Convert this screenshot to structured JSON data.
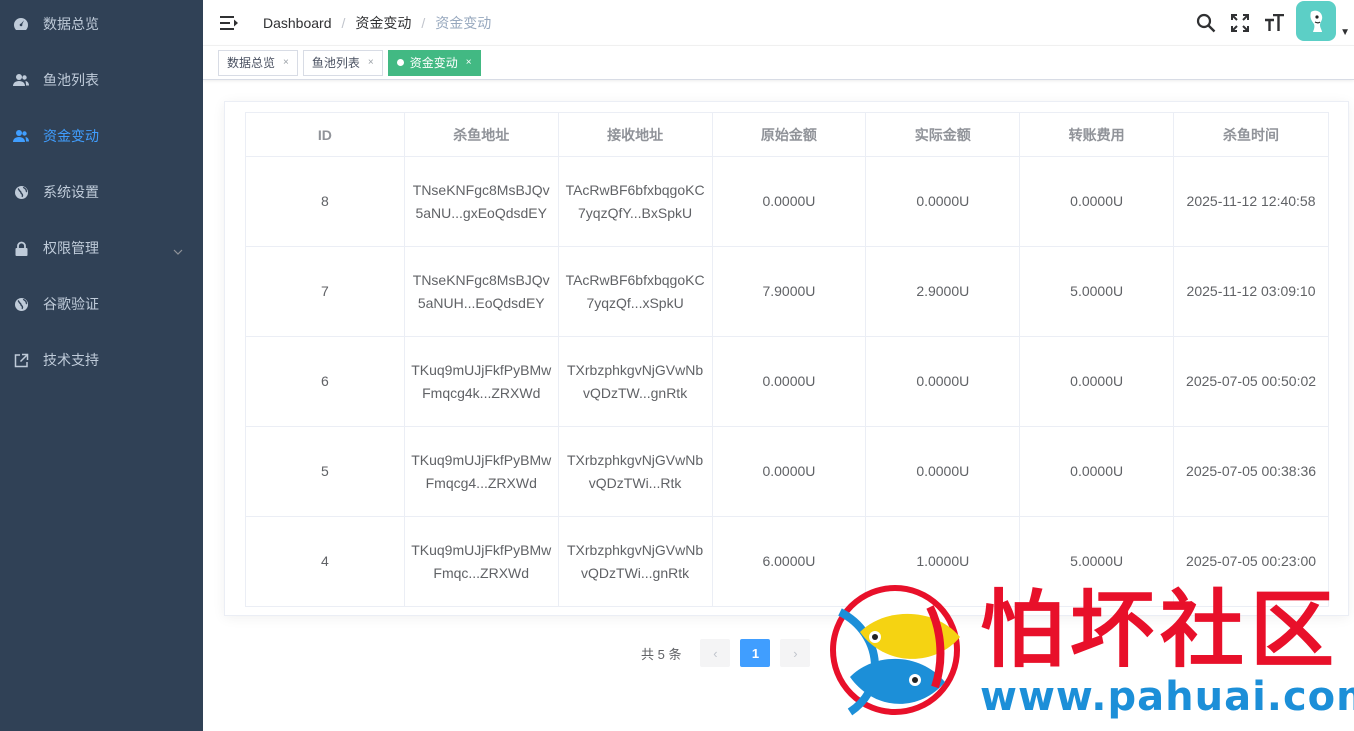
{
  "sidebar": {
    "items": [
      {
        "label": "数据总览",
        "icon": "dashboard-icon"
      },
      {
        "label": "鱼池列表",
        "icon": "users-icon"
      },
      {
        "label": "资金变动",
        "icon": "users-icon",
        "active": true
      },
      {
        "label": "系统设置",
        "icon": "globe-icon"
      },
      {
        "label": "权限管理",
        "icon": "lock-icon"
      },
      {
        "label": "谷歌验证",
        "icon": "globe-icon"
      },
      {
        "label": "技术支持",
        "icon": "external-link-icon"
      }
    ]
  },
  "navbar": {
    "breadcrumb": [
      "Dashboard",
      "资金变动",
      "资金变动"
    ],
    "separator": "/"
  },
  "tags": [
    {
      "label": "数据总览",
      "close": "×"
    },
    {
      "label": "鱼池列表",
      "close": "×"
    },
    {
      "label": "资金变动",
      "close": "×"
    }
  ],
  "table": {
    "headers": [
      "ID",
      "杀鱼地址",
      "接收地址",
      "原始金额",
      "实际金额",
      "转账费用",
      "杀鱼时间"
    ],
    "rows": [
      {
        "id": "8",
        "kill_addr": "TNseKNFgc8MsBJQv5aNU...gxEoQdsdEY",
        "recv_addr": "TAcRwBF6bfxbqgoKC7yqzQfY...BxSpkU",
        "original": "0.0000U",
        "actual": "0.0000U",
        "fee": "0.0000U",
        "time": "2025-11-12 12:40:58"
      },
      {
        "id": "7",
        "kill_addr": "TNseKNFgc8MsBJQv5aNUH...EoQdsdEY",
        "recv_addr": "TAcRwBF6bfxbqgoKC7yqzQf...xSpkU",
        "original": "7.9000U",
        "actual": "2.9000U",
        "fee": "5.0000U",
        "time": "2025-11-12 03:09:10"
      },
      {
        "id": "6",
        "kill_addr": "TKuq9mUJjFkfPyBMwFmqcg4k...ZRXWd",
        "recv_addr": "TXrbzphkgvNjGVwNbvQDzTW...gnRtk",
        "original": "0.0000U",
        "actual": "0.0000U",
        "fee": "0.0000U",
        "time": "2025-07-05 00:50:02"
      },
      {
        "id": "5",
        "kill_addr": "TKuq9mUJjFkfPyBMwFmqcg4...ZRXWd",
        "recv_addr": "TXrbzphkgvNjGVwNbvQDzTWi...Rtk",
        "original": "0.0000U",
        "actual": "0.0000U",
        "fee": "0.0000U",
        "time": "2025-07-05 00:38:36"
      },
      {
        "id": "4",
        "kill_addr": "TKuq9mUJjFkfPyBMwFmqc...ZRXWd",
        "recv_addr": "TXrbzphkgvNjGVwNbvQDzTWi...gnRtk",
        "original": "6.0000U",
        "actual": "1.0000U",
        "fee": "5.0000U",
        "time": "2025-07-05 00:23:00"
      }
    ]
  },
  "pagination": {
    "total": "共 5 条",
    "prev": "‹",
    "current": "1",
    "next": "›"
  },
  "watermark": {
    "title": "怕坏社区",
    "url": "www.pahuai.com"
  },
  "colors": {
    "sidebar_bg": "#304156",
    "sidebar_text": "#bfcbd9",
    "active": "#409eff",
    "tag_active": "#42b983"
  }
}
